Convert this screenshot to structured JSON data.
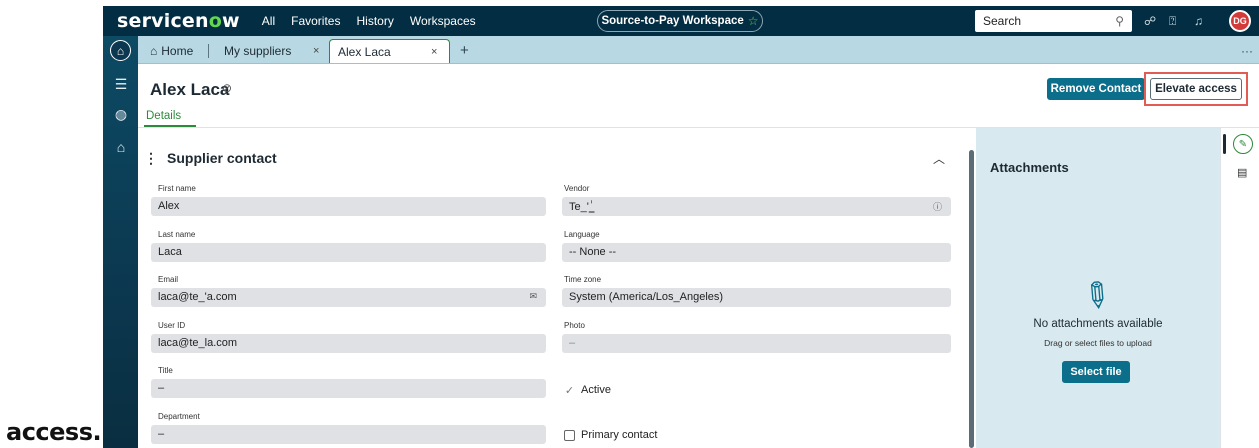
{
  "outside_caption": "access.",
  "topbar": {
    "logo_prefix": "servicen",
    "logo_o": "o",
    "logo_suffix": "w",
    "nav": [
      "All",
      "Favorites",
      "History",
      "Workspaces"
    ],
    "workspace_pill": "Source-to-Pay Workspace",
    "search_placeholder": "Search",
    "avatar_initials": "DG"
  },
  "tabs": {
    "home": "Home",
    "items": [
      {
        "label": "My suppliers"
      },
      {
        "label": "Alex Laca"
      }
    ]
  },
  "record": {
    "title": "Alex Laca",
    "remove_label": "Remove Contact",
    "elevate_label": "Elevate access",
    "details_tab": "Details"
  },
  "section": {
    "title": "Supplier contact"
  },
  "form": {
    "first_name": {
      "label": "First name",
      "value": "Alex"
    },
    "last_name": {
      "label": "Last name",
      "value": "Laca"
    },
    "email": {
      "label": "Email",
      "value": "laca@te_'a.com"
    },
    "user_id": {
      "label": "User ID",
      "value": "laca@te_la.com"
    },
    "title": {
      "label": "Title",
      "value": "–"
    },
    "department": {
      "label": "Department",
      "value": "–"
    },
    "vendor": {
      "label": "Vendor",
      "value": "Te_'_ٰ"
    },
    "language": {
      "label": "Language",
      "value": "-- None --"
    },
    "time_zone": {
      "label": "Time zone",
      "value": "System (America/Los_Angeles)"
    },
    "photo": {
      "label": "Photo",
      "value": "–"
    },
    "active": {
      "label": "Active",
      "checked": true
    },
    "primary_contact": {
      "label": "Primary contact",
      "checked": false
    }
  },
  "attachments": {
    "title": "Attachments",
    "empty": "No attachments available",
    "hint": "Drag or select files to upload",
    "select_label": "Select file"
  },
  "colors": {
    "topbar": "#032d42",
    "accent_green": "#2d8a3c",
    "primary_button": "#0b6e8a",
    "highlight": "#e05c55"
  }
}
